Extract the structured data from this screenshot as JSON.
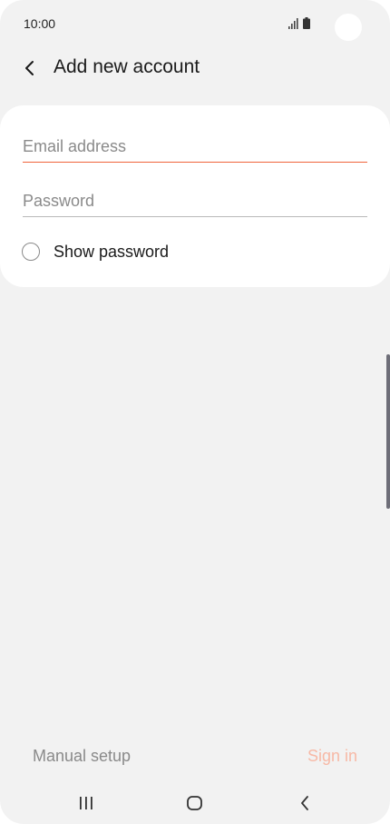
{
  "status_bar": {
    "time": "10:00"
  },
  "header": {
    "title": "Add new account",
    "back_icon": "chevron-left-icon"
  },
  "form": {
    "email": {
      "value": "",
      "placeholder": "Email address"
    },
    "password": {
      "value": "",
      "placeholder": "Password"
    },
    "show_password": {
      "label": "Show password",
      "checked": false
    }
  },
  "actions": {
    "manual_setup_label": "Manual setup",
    "sign_in_label": "Sign in"
  },
  "colors": {
    "accent": "#f0643c",
    "disabled_accent": "#f7b9a6",
    "background": "#f2f2f2",
    "card": "#ffffff"
  },
  "nav_bar": {
    "icons": [
      "recents-icon",
      "home-icon",
      "back-icon"
    ]
  }
}
